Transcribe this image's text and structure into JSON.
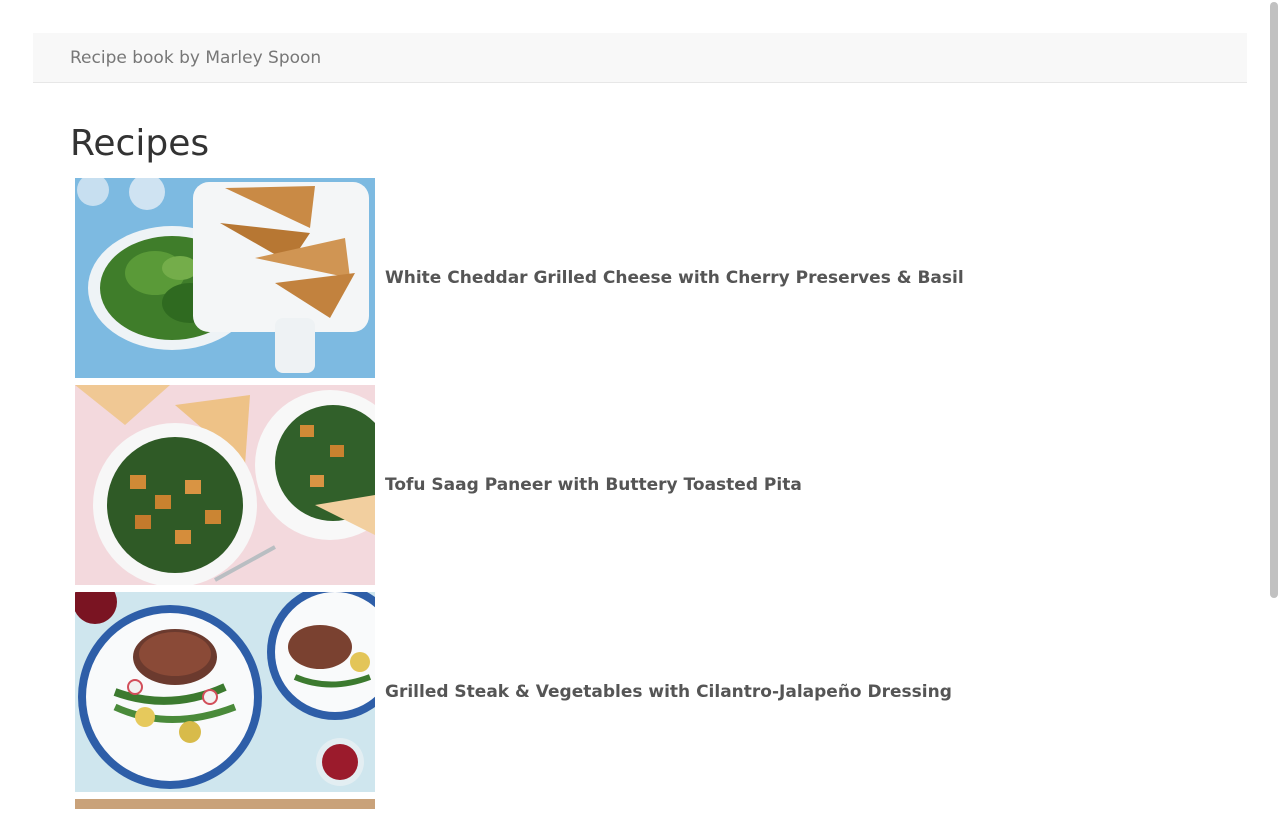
{
  "navbar": {
    "brand": "Recipe book by Marley Spoon"
  },
  "page": {
    "title": "Recipes"
  },
  "recipes": [
    {
      "title": "White Cheddar Grilled Cheese with Cherry Preserves & Basil",
      "image_icon": "grilled-cheese-photo"
    },
    {
      "title": "Tofu Saag Paneer with Buttery Toasted Pita",
      "image_icon": "saag-paneer-photo"
    },
    {
      "title": "Grilled Steak & Vegetables with Cilantro-Jalapeño Dressing",
      "image_icon": "steak-vegetables-photo"
    }
  ],
  "colors": {
    "navbar_bg": "#f8f8f8",
    "brand_text": "#777777",
    "recipe_title": "#555555"
  }
}
